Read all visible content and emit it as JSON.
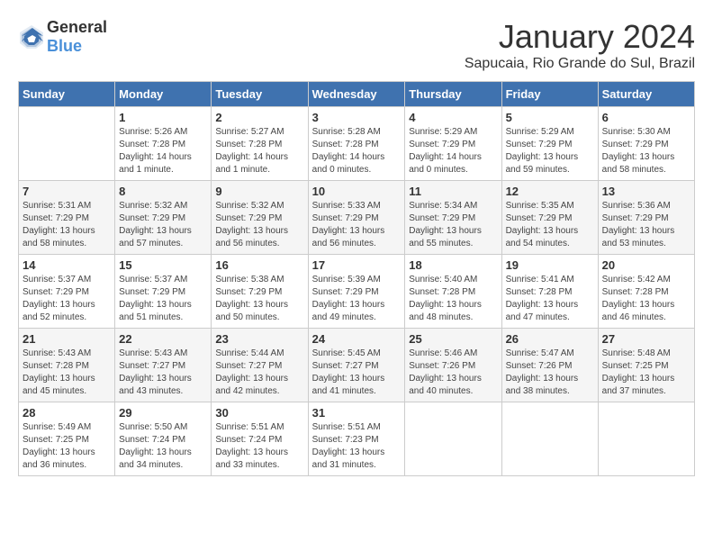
{
  "header": {
    "logo_general": "General",
    "logo_blue": "Blue",
    "title": "January 2024",
    "location": "Sapucaia, Rio Grande do Sul, Brazil"
  },
  "days_of_week": [
    "Sunday",
    "Monday",
    "Tuesday",
    "Wednesday",
    "Thursday",
    "Friday",
    "Saturday"
  ],
  "weeks": [
    [
      {
        "day": "",
        "info": ""
      },
      {
        "day": "1",
        "info": "Sunrise: 5:26 AM\nSunset: 7:28 PM\nDaylight: 14 hours\nand 1 minute."
      },
      {
        "day": "2",
        "info": "Sunrise: 5:27 AM\nSunset: 7:28 PM\nDaylight: 14 hours\nand 1 minute."
      },
      {
        "day": "3",
        "info": "Sunrise: 5:28 AM\nSunset: 7:28 PM\nDaylight: 14 hours\nand 0 minutes."
      },
      {
        "day": "4",
        "info": "Sunrise: 5:29 AM\nSunset: 7:29 PM\nDaylight: 14 hours\nand 0 minutes."
      },
      {
        "day": "5",
        "info": "Sunrise: 5:29 AM\nSunset: 7:29 PM\nDaylight: 13 hours\nand 59 minutes."
      },
      {
        "day": "6",
        "info": "Sunrise: 5:30 AM\nSunset: 7:29 PM\nDaylight: 13 hours\nand 58 minutes."
      }
    ],
    [
      {
        "day": "7",
        "info": "Sunrise: 5:31 AM\nSunset: 7:29 PM\nDaylight: 13 hours\nand 58 minutes."
      },
      {
        "day": "8",
        "info": "Sunrise: 5:32 AM\nSunset: 7:29 PM\nDaylight: 13 hours\nand 57 minutes."
      },
      {
        "day": "9",
        "info": "Sunrise: 5:32 AM\nSunset: 7:29 PM\nDaylight: 13 hours\nand 56 minutes."
      },
      {
        "day": "10",
        "info": "Sunrise: 5:33 AM\nSunset: 7:29 PM\nDaylight: 13 hours\nand 56 minutes."
      },
      {
        "day": "11",
        "info": "Sunrise: 5:34 AM\nSunset: 7:29 PM\nDaylight: 13 hours\nand 55 minutes."
      },
      {
        "day": "12",
        "info": "Sunrise: 5:35 AM\nSunset: 7:29 PM\nDaylight: 13 hours\nand 54 minutes."
      },
      {
        "day": "13",
        "info": "Sunrise: 5:36 AM\nSunset: 7:29 PM\nDaylight: 13 hours\nand 53 minutes."
      }
    ],
    [
      {
        "day": "14",
        "info": "Sunrise: 5:37 AM\nSunset: 7:29 PM\nDaylight: 13 hours\nand 52 minutes."
      },
      {
        "day": "15",
        "info": "Sunrise: 5:37 AM\nSunset: 7:29 PM\nDaylight: 13 hours\nand 51 minutes."
      },
      {
        "day": "16",
        "info": "Sunrise: 5:38 AM\nSunset: 7:29 PM\nDaylight: 13 hours\nand 50 minutes."
      },
      {
        "day": "17",
        "info": "Sunrise: 5:39 AM\nSunset: 7:29 PM\nDaylight: 13 hours\nand 49 minutes."
      },
      {
        "day": "18",
        "info": "Sunrise: 5:40 AM\nSunset: 7:28 PM\nDaylight: 13 hours\nand 48 minutes."
      },
      {
        "day": "19",
        "info": "Sunrise: 5:41 AM\nSunset: 7:28 PM\nDaylight: 13 hours\nand 47 minutes."
      },
      {
        "day": "20",
        "info": "Sunrise: 5:42 AM\nSunset: 7:28 PM\nDaylight: 13 hours\nand 46 minutes."
      }
    ],
    [
      {
        "day": "21",
        "info": "Sunrise: 5:43 AM\nSunset: 7:28 PM\nDaylight: 13 hours\nand 45 minutes."
      },
      {
        "day": "22",
        "info": "Sunrise: 5:43 AM\nSunset: 7:27 PM\nDaylight: 13 hours\nand 43 minutes."
      },
      {
        "day": "23",
        "info": "Sunrise: 5:44 AM\nSunset: 7:27 PM\nDaylight: 13 hours\nand 42 minutes."
      },
      {
        "day": "24",
        "info": "Sunrise: 5:45 AM\nSunset: 7:27 PM\nDaylight: 13 hours\nand 41 minutes."
      },
      {
        "day": "25",
        "info": "Sunrise: 5:46 AM\nSunset: 7:26 PM\nDaylight: 13 hours\nand 40 minutes."
      },
      {
        "day": "26",
        "info": "Sunrise: 5:47 AM\nSunset: 7:26 PM\nDaylight: 13 hours\nand 38 minutes."
      },
      {
        "day": "27",
        "info": "Sunrise: 5:48 AM\nSunset: 7:25 PM\nDaylight: 13 hours\nand 37 minutes."
      }
    ],
    [
      {
        "day": "28",
        "info": "Sunrise: 5:49 AM\nSunset: 7:25 PM\nDaylight: 13 hours\nand 36 minutes."
      },
      {
        "day": "29",
        "info": "Sunrise: 5:50 AM\nSunset: 7:24 PM\nDaylight: 13 hours\nand 34 minutes."
      },
      {
        "day": "30",
        "info": "Sunrise: 5:51 AM\nSunset: 7:24 PM\nDaylight: 13 hours\nand 33 minutes."
      },
      {
        "day": "31",
        "info": "Sunrise: 5:51 AM\nSunset: 7:23 PM\nDaylight: 13 hours\nand 31 minutes."
      },
      {
        "day": "",
        "info": ""
      },
      {
        "day": "",
        "info": ""
      },
      {
        "day": "",
        "info": ""
      }
    ]
  ]
}
